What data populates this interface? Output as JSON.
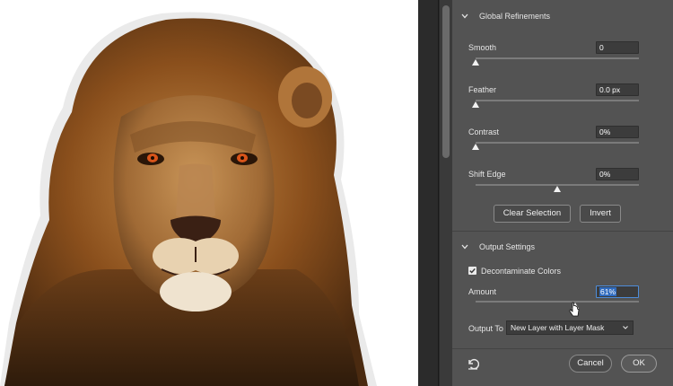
{
  "image": {
    "subject": "lion-portrait",
    "colors": {
      "mane": "#8a4f1c",
      "mane_light": "#c58a47",
      "face": "#b27b45",
      "shadow": "#3a2410"
    }
  },
  "panel": {
    "global_refinements": {
      "title": "Global Refinements",
      "smooth": {
        "label": "Smooth",
        "value": "0",
        "level": 0.0
      },
      "feather": {
        "label": "Feather",
        "value": "0.0 px",
        "level": 0.0
      },
      "contrast": {
        "label": "Contrast",
        "value": "0%",
        "level": 0.0
      },
      "shift_edge": {
        "label": "Shift Edge",
        "value": "0%",
        "level": 0.5
      },
      "clear_selection_label": "Clear Selection",
      "invert_label": "Invert"
    },
    "output_settings": {
      "title": "Output Settings",
      "decontaminate_label": "Decontaminate Colors",
      "decontaminate_checked": true,
      "amount": {
        "label": "Amount",
        "value": "61%",
        "level": 0.61
      },
      "output_to_label": "Output To",
      "output_to_value": "New Layer with Layer Mask"
    },
    "footer": {
      "cancel_label": "Cancel",
      "ok_label": "OK"
    }
  },
  "icons": [
    "chevron-down-icon",
    "checkbox-check-icon",
    "dropdown-caret-icon",
    "reset-icon",
    "mouse-cursor-icon"
  ]
}
